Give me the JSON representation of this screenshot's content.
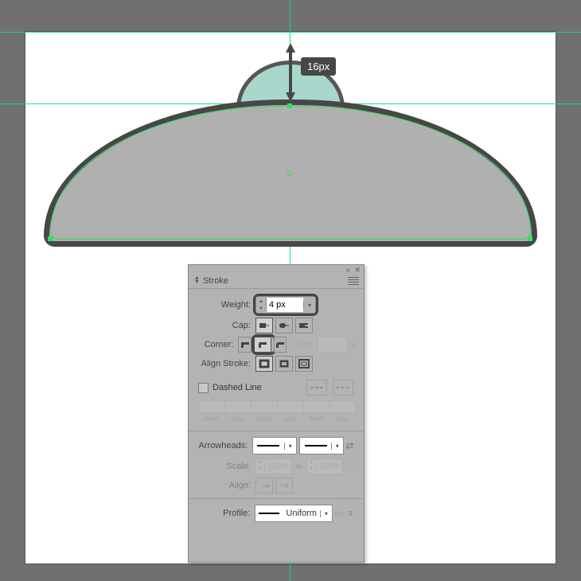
{
  "measurement": {
    "value": "16px"
  },
  "panel": {
    "title": "Stroke",
    "weight_label": "Weight:",
    "weight_value": "4 px",
    "cap_label": "Cap:",
    "corner_label": "Corner:",
    "limit_label": "Limit:",
    "limit_unit": "x",
    "align_label": "Align Stroke:",
    "dashed_label": "Dashed Line",
    "dash_caps": [
      "dash",
      "gap",
      "dash",
      "gap",
      "dash",
      "gap"
    ],
    "arrowheads_label": "Arrowheads:",
    "scale_label": "Scale:",
    "scale_value": "100%",
    "align_arrow_label": "Align:",
    "profile_label": "Profile:",
    "profile_value": "Uniform"
  }
}
